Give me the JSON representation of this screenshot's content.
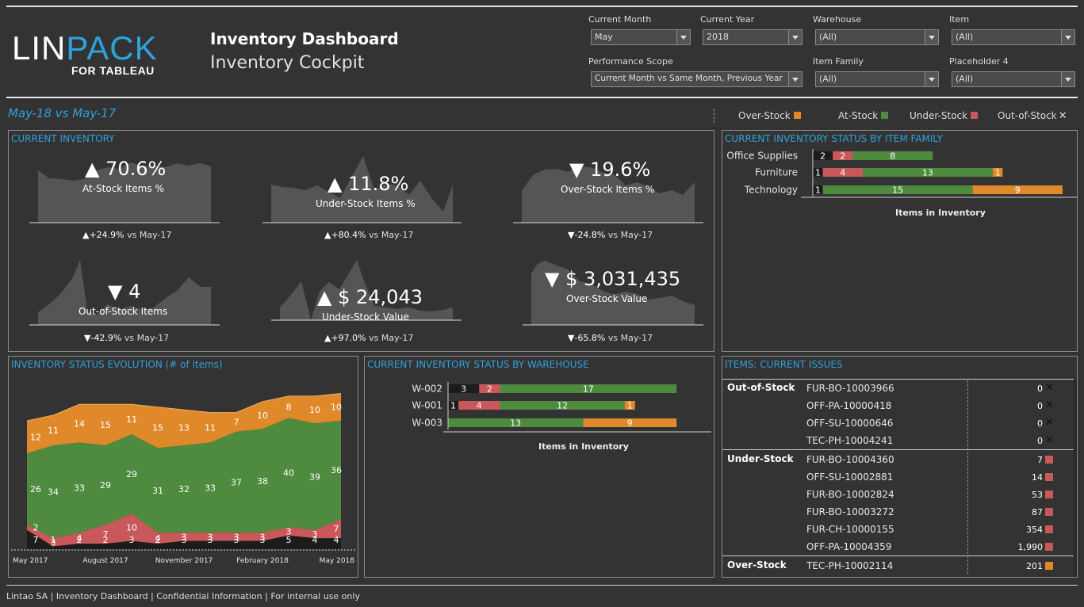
{
  "header": {
    "logo_main_white": "LIN",
    "logo_main_blue": "PACK",
    "logo_sub": "FOR TABLEAU",
    "title": "Inventory Dashboard",
    "subtitle": "Inventory Cockpit"
  },
  "filters": {
    "current_month": {
      "label": "Current Month",
      "value": "May"
    },
    "current_year": {
      "label": "Current Year",
      "value": "2018"
    },
    "warehouse": {
      "label": "Warehouse",
      "value": "(All)"
    },
    "item": {
      "label": "Item",
      "value": "(All)"
    },
    "performance_scope": {
      "label": "Performance Scope",
      "value": "Current Month vs Same Month, Previous Year"
    },
    "item_family": {
      "label": "Item Family",
      "value": "(All)"
    },
    "placeholder4": {
      "label": "Placeholder 4",
      "value": "(All)"
    }
  },
  "period_label": "May-18 vs May-17",
  "legend": {
    "over": "Over-Stock",
    "at": "At-Stock",
    "under": "Under-Stock",
    "out": "Out-of-Stock"
  },
  "colors": {
    "over": "#e0892a",
    "at": "#4e8b3f",
    "under": "#c9585a",
    "out": "#1c1c1c",
    "accent": "#2fa1dc",
    "spark": "#555555"
  },
  "current_inventory": {
    "title": "CURRENT INVENTORY",
    "kpis": [
      {
        "arrow": "▲",
        "value": "70.6%",
        "label": "At-Stock Items %",
        "cmp_arrow": "▲",
        "cmp": "+24.9%",
        "vs": "vs May-17"
      },
      {
        "arrow": "▲",
        "value": "11.8%",
        "label": "Under-Stock Items %",
        "cmp_arrow": "▲",
        "cmp": "+80.4%",
        "vs": "vs May-17"
      },
      {
        "arrow": "▼",
        "value": "19.6%",
        "label": "Over-Stock Items %",
        "cmp_arrow": "▼",
        "cmp": "-24.8%",
        "vs": "vs May-17"
      },
      {
        "arrow": "▼",
        "value": "4",
        "label": "Out-of-Stock Items",
        "cmp_arrow": "▼",
        "cmp": "-42.9%",
        "vs": "vs May-17"
      },
      {
        "arrow": "▲",
        "value": "$ 24,043",
        "label": "Under-Stock Value",
        "cmp_arrow": "▲",
        "cmp": "+97.0%",
        "vs": "vs May-17"
      },
      {
        "arrow": "▼",
        "value": "$ 3,031,435",
        "label": "Over-Stock Value",
        "cmp_arrow": "▼",
        "cmp": "-65.8%",
        "vs": "vs May-17"
      }
    ]
  },
  "by_family": {
    "title": "CURRENT INVENTORY STATUS BY ITEM FAMILY",
    "axis_label": "Items in Inventory",
    "rows": [
      {
        "name": "Office Supplies",
        "out": 2,
        "under": 2,
        "at": 8,
        "over": 0
      },
      {
        "name": "Furniture",
        "out": 1,
        "under": 4,
        "at": 13,
        "over": 1
      },
      {
        "name": "Technology",
        "out": 1,
        "under": 0,
        "at": 15,
        "over": 9
      }
    ]
  },
  "evolution": {
    "title": "INVENTORY STATUS EVOLUTION (# of items)",
    "x_labels": [
      "May 2017",
      "August 2017",
      "November 2017",
      "February 2018",
      "May 2018"
    ]
  },
  "chart_data": {
    "type": "area",
    "title": "INVENTORY STATUS EVOLUTION (# of items)",
    "x": [
      "2017-05",
      "2017-06",
      "2017-07",
      "2017-08",
      "2017-09",
      "2017-10",
      "2017-11",
      "2017-12",
      "2018-01",
      "2018-02",
      "2018-03",
      "2018-04",
      "2018-05"
    ],
    "stacked": true,
    "series": [
      {
        "name": "Out-of-Stock",
        "values": [
          7,
          1,
          2,
          2,
          3,
          2,
          3,
          3,
          3,
          3,
          5,
          4,
          4
        ]
      },
      {
        "name": "Under-Stock",
        "values": [
          2,
          3,
          4,
          7,
          10,
          4,
          3,
          3,
          3,
          3,
          3,
          3,
          7
        ]
      },
      {
        "name": "At-Stock",
        "values": [
          26,
          34,
          33,
          29,
          29,
          31,
          32,
          33,
          37,
          38,
          40,
          39,
          36
        ]
      },
      {
        "name": "Over-Stock",
        "values": [
          12,
          11,
          14,
          15,
          11,
          15,
          13,
          11,
          7,
          10,
          8,
          10,
          10
        ]
      }
    ],
    "x_tick_labels": [
      "May 2017",
      "August 2017",
      "November 2017",
      "February 2018",
      "May 2018"
    ],
    "grid": false,
    "legend": "top-right"
  },
  "by_warehouse": {
    "title": "CURRENT INVENTORY STATUS BY WAREHOUSE",
    "axis_label": "Items in Inventory",
    "rows": [
      {
        "name": "W-002",
        "out": 3,
        "under": 2,
        "at": 17,
        "over": 0
      },
      {
        "name": "W-001",
        "out": 1,
        "under": 4,
        "at": 12,
        "over": 1
      },
      {
        "name": "W-003",
        "out": 0,
        "under": 0,
        "at": 13,
        "over": 9
      }
    ]
  },
  "issues": {
    "title": "ITEMS: CURRENT ISSUES",
    "groups": [
      {
        "category": "Out-of-Stock",
        "kind": "out",
        "items": [
          {
            "id": "FUR-BO-10003966",
            "value": "0"
          },
          {
            "id": "OFF-PA-10000418",
            "value": "0"
          },
          {
            "id": "OFF-SU-10000646",
            "value": "0"
          },
          {
            "id": "TEC-PH-10004241",
            "value": "0"
          }
        ]
      },
      {
        "category": "Under-Stock",
        "kind": "under",
        "items": [
          {
            "id": "FUR-BO-10004360",
            "value": "7"
          },
          {
            "id": "OFF-SU-10002881",
            "value": "14"
          },
          {
            "id": "FUR-BO-10002824",
            "value": "53"
          },
          {
            "id": "FUR-BO-10003272",
            "value": "87"
          },
          {
            "id": "FUR-CH-10000155",
            "value": "354"
          },
          {
            "id": "OFF-PA-10004359",
            "value": "1,990"
          }
        ]
      },
      {
        "category": "Over-Stock",
        "kind": "over",
        "items": [
          {
            "id": "TEC-PH-10002114",
            "value": "201"
          }
        ]
      }
    ]
  },
  "footer": "Lintao SA | Inventory Dashboard  | Confidential Information | For internal use only"
}
